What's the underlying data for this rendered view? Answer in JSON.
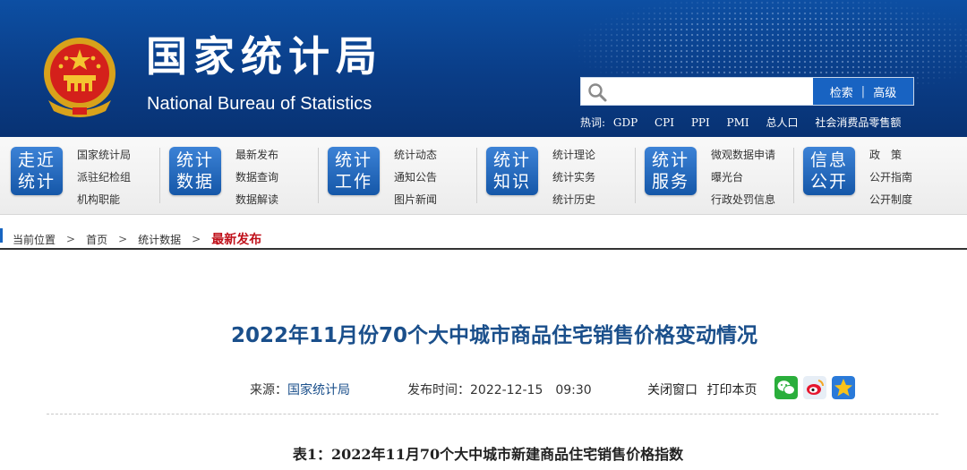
{
  "header": {
    "title_cn": "国家统计局",
    "title_en": "National Bureau of Statistics",
    "search": {
      "placeholder": "",
      "search_label": "检索",
      "advanced_label": "高级"
    },
    "hot": {
      "label": "热词:",
      "words": [
        "GDP",
        "CPI",
        "PPI",
        "PMI",
        "总人口",
        "社会消费品零售额"
      ]
    }
  },
  "nav": [
    {
      "badge": [
        "走近",
        "统计"
      ],
      "links": [
        "国家统计局",
        "派驻纪检组",
        "机构职能"
      ]
    },
    {
      "badge": [
        "统计",
        "数据"
      ],
      "links": [
        "最新发布",
        "数据查询",
        "数据解读"
      ]
    },
    {
      "badge": [
        "统计",
        "工作"
      ],
      "links": [
        "统计动态",
        "通知公告",
        "图片新闻"
      ]
    },
    {
      "badge": [
        "统计",
        "知识"
      ],
      "links": [
        "统计理论",
        "统计实务",
        "统计历史"
      ]
    },
    {
      "badge": [
        "统计",
        "服务"
      ],
      "links": [
        "微观数据申请",
        "曝光台",
        "行政处罚信息"
      ]
    },
    {
      "badge": [
        "信息",
        "公开"
      ],
      "links": [
        "政　策",
        "公开指南",
        "公开制度"
      ]
    }
  ],
  "breadcrumb": {
    "label": "当前位置",
    "items": [
      "首页",
      "统计数据"
    ],
    "current": "最新发布"
  },
  "article": {
    "title": "2022年11月份70个大中城市商品住宅销售价格变动情况",
    "source_label": "来源：",
    "source": "国家统计局",
    "time_label": "发布时间：",
    "time": "2022-12-15　09:30",
    "close_label": "关闭窗口",
    "print_label": "打印本页",
    "table_title": "表1：2022年11月70个大中城市新建商品住宅销售价格指数"
  },
  "colors": {
    "header_blue": "#0a3d87",
    "badge_blue": "#1557a8",
    "title_blue": "#1a4f8b",
    "crumb_red": "#c0111b"
  }
}
